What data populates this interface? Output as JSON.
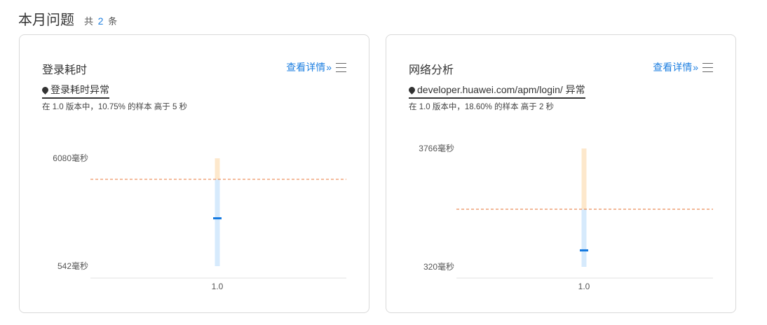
{
  "header": {
    "title": "本月问题",
    "count_prefix": "共",
    "count": "2",
    "count_suffix": "条"
  },
  "cards": [
    {
      "title": "登录耗时",
      "detail_label": "查看详情",
      "issue": "登录耗时异常",
      "description": "在 1.0 版本中，10.75% 的样本 高于 5 秒",
      "chart_data": {
        "type": "range",
        "categories": [
          "1.0"
        ],
        "y_labels": {
          "max": "6080毫秒",
          "min": "542毫秒"
        },
        "ylim": [
          542,
          6080
        ],
        "range": [
          542,
          6080
        ],
        "threshold": 5000,
        "median": 3000,
        "colors": {
          "above": "#fde8cc",
          "below": "#d6eafc",
          "median": "#1479e0",
          "threshold": "#e8783a"
        }
      }
    },
    {
      "title": "网络分析",
      "detail_label": "查看详情",
      "issue": "developer.huawei.com/apm/login/ 异常",
      "description": "在 1.0 版本中，18.60% 的样本 高于 2 秒",
      "chart_data": {
        "type": "range",
        "categories": [
          "1.0"
        ],
        "y_labels": {
          "max": "3766毫秒",
          "min": "320毫秒"
        },
        "ylim": [
          320,
          3766
        ],
        "range": [
          320,
          3766
        ],
        "threshold": 2000,
        "median": 800,
        "colors": {
          "above": "#fde8cc",
          "below": "#d6eafc",
          "median": "#1479e0",
          "threshold": "#e8783a"
        }
      }
    }
  ]
}
